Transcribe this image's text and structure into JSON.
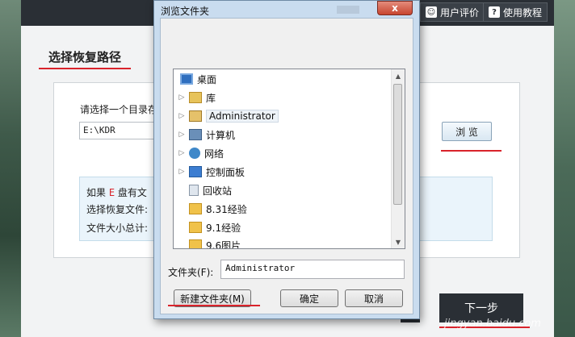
{
  "topbar": {
    "feedback_label": "用户评价",
    "tutorial_label": "使用教程"
  },
  "main": {
    "section_title": "选择恢复路径",
    "prompt": "请选择一个目录存",
    "path_value": "E:\\KDR",
    "browse_label": "浏 览",
    "info": {
      "line1_prefix": "如果",
      "line1_drive": "E",
      "line1_suffix": "盘有文",
      "line2": "选择恢复文件:",
      "line3": "文件大小总计:"
    },
    "next_label": "下一步"
  },
  "dialog": {
    "title": "浏览文件夹",
    "close_label": "x",
    "tree": [
      {
        "label": "桌面",
        "icon": "desktop-icon",
        "arrow": ""
      },
      {
        "label": "库",
        "icon": "library-icon",
        "arrow": "▷"
      },
      {
        "label": "Administrator",
        "icon": "user-folder-icon",
        "arrow": "▷"
      },
      {
        "label": "计算机",
        "icon": "computer-icon",
        "arrow": "▷"
      },
      {
        "label": "网络",
        "icon": "network-icon",
        "arrow": "▷"
      },
      {
        "label": "控制面板",
        "icon": "control-panel-icon",
        "arrow": "▷"
      },
      {
        "label": "回收站",
        "icon": "recycle-bin-icon",
        "arrow": ""
      },
      {
        "label": "8.31经验",
        "icon": "folder-icon",
        "arrow": ""
      },
      {
        "label": "9.1经验",
        "icon": "folder-icon",
        "arrow": ""
      },
      {
        "label": "9.6图片",
        "icon": "folder-icon",
        "arrow": ""
      }
    ],
    "folder_label": "文件夹(F):",
    "folder_value": "Administrator",
    "new_folder_label": "新建文件夹(M)",
    "ok_label": "确定",
    "cancel_label": "取消"
  },
  "watermark": "jingyan.baidu.com",
  "colors": {
    "accent_red": "#d9232b",
    "topbar": "#2a2f35",
    "dialog_frame": "#c9dcef"
  }
}
